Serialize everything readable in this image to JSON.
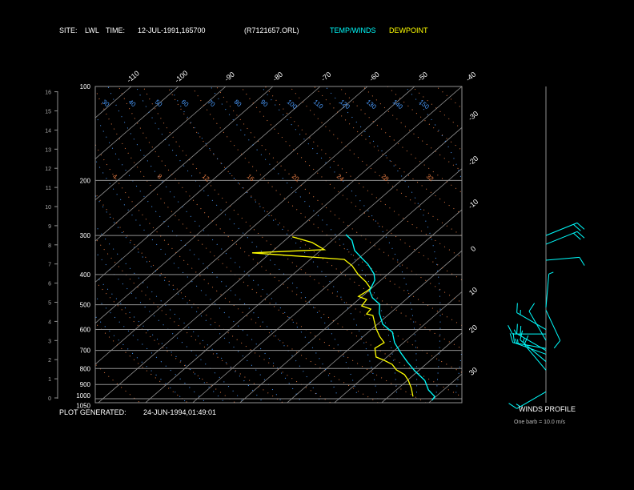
{
  "header": {
    "site_label": "SITE:",
    "site": "LWL",
    "time_label": "TIME:",
    "time": "12-JUL-1991,165700",
    "file": "(R7121657.ORL)",
    "legend_temp": "TEMP/WINDS",
    "legend_dew": "DEWPOINT"
  },
  "footer": {
    "generated_label": "PLOT GENERATED:",
    "generated": "24-JUN-1994,01:49:01",
    "winds_title": "WINDS PROFILE",
    "barb_note": "One barb = 10.0 m/s"
  },
  "colors": {
    "background": "#000000",
    "temp": "#00ffff",
    "dewpoint": "#ffff00",
    "isobar": "#909090",
    "isotherm": "#909090",
    "dry_adiabat": "#e07840",
    "moist_adiabat": "#4a9cff"
  },
  "chart_data": {
    "type": "skew-t log-p",
    "pressure_axis": {
      "ticks": [
        "100",
        "200",
        "300",
        "400",
        "500",
        "600",
        "700",
        "800",
        "900",
        "1000",
        "1050"
      ],
      "range": [
        1050,
        100
      ],
      "scale": "log"
    },
    "height_axis": {
      "unit": "km",
      "ticks": [
        "0",
        "1",
        "2",
        "3",
        "4",
        "5",
        "6",
        "7",
        "8",
        "9",
        "10",
        "11",
        "12",
        "13",
        "14",
        "15",
        "16"
      ]
    },
    "temp_top_ticks": [
      "-110",
      "-100",
      "-90",
      "-80",
      "-70",
      "-60",
      "-50",
      "-40"
    ],
    "temp_right_ticks": [
      "-30",
      "-20",
      "-10",
      "0",
      "10",
      "20",
      "30"
    ],
    "theta_labels": [
      "30",
      "40",
      "50",
      "60",
      "70",
      "80",
      "90",
      "100",
      "110",
      "120",
      "130",
      "140",
      "150"
    ],
    "mixing_labels": [
      "4",
      "8",
      "12",
      "16",
      "20",
      "24",
      "28",
      "32"
    ],
    "temperature": [
      [
        298,
        -28.5
      ],
      [
        311,
        -25.8
      ],
      [
        335,
        -22.8
      ],
      [
        354,
        -19.5
      ],
      [
        371,
        -16.6
      ],
      [
        398,
        -13.0
      ],
      [
        417,
        -11.3
      ],
      [
        451,
        -9.8
      ],
      [
        475,
        -7.5
      ],
      [
        498,
        -4.4
      ],
      [
        532,
        -2.3
      ],
      [
        577,
        1.1
      ],
      [
        612,
        5.1
      ],
      [
        661,
        8.1
      ],
      [
        710,
        11.7
      ],
      [
        762,
        15.5
      ],
      [
        813,
        19.2
      ],
      [
        873,
        23.7
      ],
      [
        937,
        26.8
      ],
      [
        983,
        29.7
      ],
      [
        1011,
        30.1
      ]
    ],
    "dewpoint": [
      [
        303,
        -39.3
      ],
      [
        316,
        -33.7
      ],
      [
        333,
        -29.4
      ],
      [
        341,
        -43.9
      ],
      [
        346,
        -37.5
      ],
      [
        358,
        -22.8
      ],
      [
        375,
        -19.6
      ],
      [
        400,
        -16.2
      ],
      [
        422,
        -12.8
      ],
      [
        443,
        -10.2
      ],
      [
        453,
        -10.3
      ],
      [
        470,
        -10.8
      ],
      [
        481,
        -8.3
      ],
      [
        504,
        -7.8
      ],
      [
        516,
        -5.1
      ],
      [
        535,
        -4.8
      ],
      [
        541,
        -3.1
      ],
      [
        595,
        0.7
      ],
      [
        631,
        3.4
      ],
      [
        661,
        5.9
      ],
      [
        689,
        5.3
      ],
      [
        735,
        7.7
      ],
      [
        753,
        10.2
      ],
      [
        776,
        12.9
      ],
      [
        808,
        15.1
      ],
      [
        837,
        18.0
      ],
      [
        873,
        20.2
      ],
      [
        926,
        22.8
      ],
      [
        983,
        25.1
      ]
    ],
    "winds": [
      {
        "p": 300,
        "dir": 68,
        "speed": 20
      },
      {
        "p": 320,
        "dir": 68,
        "speed": 20
      },
      {
        "p": 360,
        "dir": 85,
        "speed": 10
      },
      {
        "p": 510,
        "dir": 5,
        "speed": 5
      },
      {
        "p": 520,
        "dir": 155,
        "speed": 10
      },
      {
        "p": 600,
        "dir": 300,
        "speed": 15
      },
      {
        "p": 620,
        "dir": 270,
        "speed": 15
      },
      {
        "p": 650,
        "dir": 330,
        "speed": 10
      },
      {
        "p": 690,
        "dir": 280,
        "speed": 15
      },
      {
        "p": 700,
        "dir": 300,
        "speed": 20
      },
      {
        "p": 720,
        "dir": 290,
        "speed": 15
      },
      {
        "p": 760,
        "dir": 310,
        "speed": 15
      },
      {
        "p": 810,
        "dir": 320,
        "speed": 10
      },
      {
        "p": 950,
        "dir": 240,
        "speed": 15
      }
    ]
  }
}
